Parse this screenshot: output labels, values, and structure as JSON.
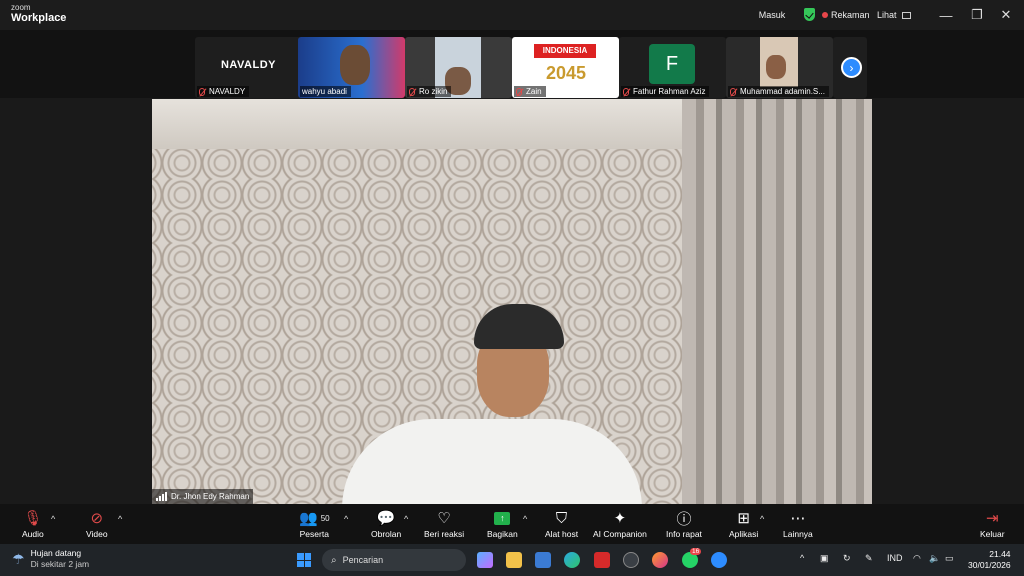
{
  "app": {
    "logo_small": "zoom",
    "logo_big": "Workplace"
  },
  "titlebar": {
    "sign_in": "Masuk",
    "recording": "Rekaman",
    "view": "Lihat",
    "minimize": "—",
    "restore": "❐",
    "close": "✕"
  },
  "participants": [
    {
      "name": "NAVALDY",
      "display": "NAVALDY",
      "muted": true
    },
    {
      "name": "wahyu abadi",
      "muted": false
    },
    {
      "name": "Ro zikin",
      "muted": true
    },
    {
      "name": "Zain",
      "muted": true
    },
    {
      "name": "Fathur Rahman Aziz",
      "initial": "F",
      "muted": true
    },
    {
      "name": "Muhammad adamin.S...",
      "muted": true
    }
  ],
  "thumb_texts": {
    "banner_title": "INDONESIA",
    "banner_year": "2045"
  },
  "main_video": {
    "speaker": "Dr. Jhon Edy Rahman"
  },
  "toolbar": {
    "audio": "Audio",
    "video": "Video",
    "participants": "Peserta",
    "participant_count": "50",
    "chat": "Obrolan",
    "reactions": "Beri reaksi",
    "share": "Bagikan",
    "host_tools": "Alat host",
    "ai": "AI Companion",
    "info": "Info rapat",
    "apps": "Aplikasi",
    "more": "Lainnya",
    "leave": "Keluar"
  },
  "taskbar": {
    "weather_title": "Hujan datang",
    "weather_sub": "Di sekitar 2 jam",
    "search_placeholder": "Pencarian",
    "lang": "IND",
    "time": "21.44",
    "date": "30/01/2026",
    "whatsapp_badge": "16"
  }
}
